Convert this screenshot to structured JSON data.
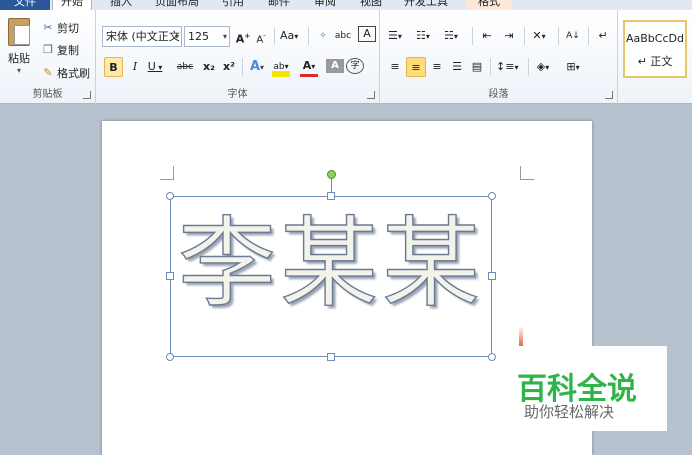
{
  "tabs": [
    {
      "label": "文件"
    },
    {
      "label": "开始"
    },
    {
      "label": "插入"
    },
    {
      "label": "页面布局"
    },
    {
      "label": "引用"
    },
    {
      "label": "邮件"
    },
    {
      "label": "审阅"
    },
    {
      "label": "视图"
    },
    {
      "label": "开发工具"
    },
    {
      "label": "格式"
    }
  ],
  "clipboard": {
    "paste": "粘贴",
    "cut": "剪切",
    "copy": "复制",
    "format_painter": "格式刷",
    "group_label": "剪贴板"
  },
  "font": {
    "font_name": "宋体 (中文正文)",
    "font_size": "125",
    "group_label": "字体",
    "grow": "A",
    "shrink": "A",
    "change_case": "Aa",
    "phonetic": "abc",
    "char_border": "A",
    "bold": "B",
    "italic": "I",
    "underline": "U",
    "strike": "abc",
    "subscript": "x₂",
    "superscript": "x²",
    "text_effects": "A",
    "highlight": "ab",
    "font_color": "A",
    "char_shading": "A",
    "enclose": "字"
  },
  "paragraph": {
    "group_label": "段落"
  },
  "styles": {
    "sample": "AaBbCcDd",
    "name": "↵ 正文"
  },
  "document": {
    "wordart_text": "李某某"
  },
  "watermark": {
    "title": "百科全说",
    "subtitle": "助你轻松解决"
  },
  "colors": {
    "file_tab": "#2b579a",
    "watermark_green": "#2fb44a",
    "selection_border": "#6d8cb7",
    "rotation_handle": "#8fd15a"
  }
}
